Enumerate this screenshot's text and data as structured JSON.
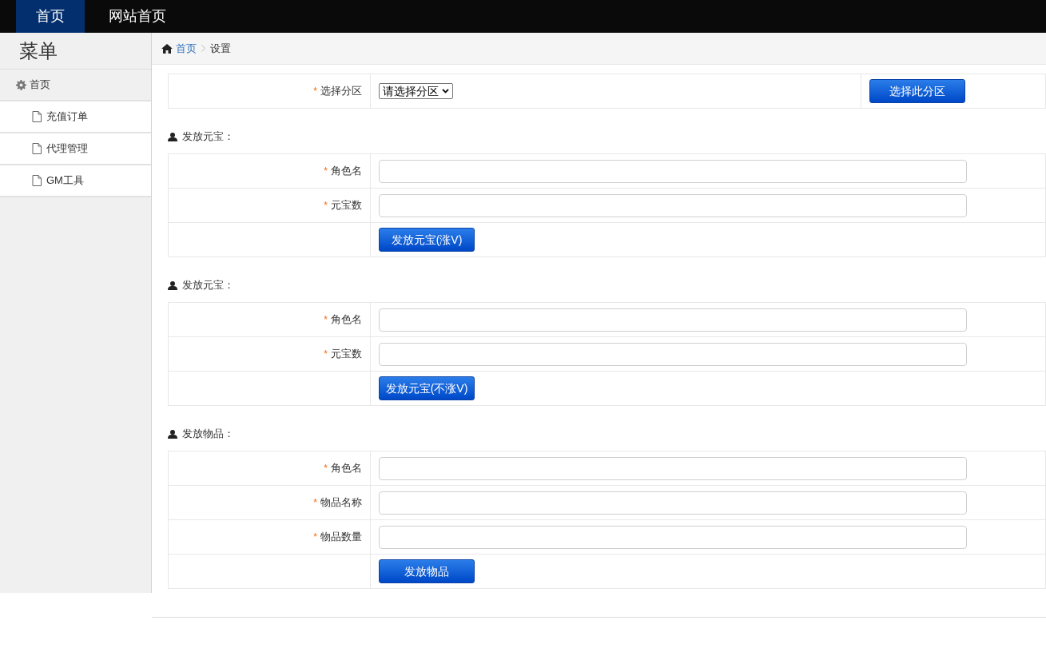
{
  "top_nav": [
    {
      "label": "首页",
      "selected": true
    },
    {
      "label": "网站首页",
      "selected": false
    }
  ],
  "sidebar": {
    "title": "菜单",
    "items": [
      {
        "label": "首页",
        "children": [
          {
            "label": "充值订单"
          },
          {
            "label": "代理管理"
          },
          {
            "label": "GM工具"
          }
        ]
      }
    ]
  },
  "breadcrumb": [
    "首页",
    "设置"
  ],
  "zone": {
    "mark": "*",
    "label": "选择分区",
    "select": "请选择分区",
    "button": "选择此分区"
  },
  "sections": [
    {
      "title": "发放元宝：",
      "fields": [
        {
          "mark": "*",
          "label": "角色名"
        },
        {
          "mark": "*",
          "label": "元宝数"
        }
      ],
      "button": "发放元宝(涨V)"
    },
    {
      "title": "发放元宝：",
      "fields": [
        {
          "mark": "*",
          "label": "角色名"
        },
        {
          "mark": "*",
          "label": "元宝数"
        }
      ],
      "button": "发放元宝(不涨V)"
    },
    {
      "title": "发放物品：",
      "fields": [
        {
          "mark": "*",
          "label": "角色名"
        },
        {
          "mark": "*",
          "label": "物品名称"
        },
        {
          "mark": "*",
          "label": "物品数量"
        }
      ],
      "button": "发放物品"
    }
  ]
}
